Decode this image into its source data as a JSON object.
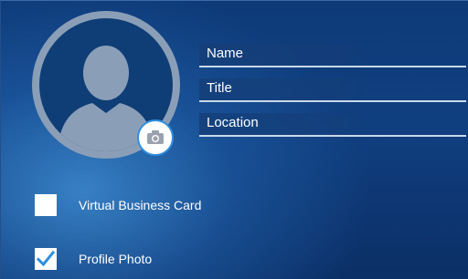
{
  "profile": {
    "avatar_icon": "person-silhouette-icon",
    "camera_icon": "camera-icon"
  },
  "fields": {
    "name_label": "Name",
    "title_label": "Title",
    "location_label": "Location"
  },
  "options": {
    "virtual_business_card": {
      "label": "Virtual Business Card",
      "checked": false
    },
    "profile_photo": {
      "label": "Profile Photo",
      "checked": true
    }
  },
  "colors": {
    "accent": "#2f8fe0",
    "background": "#0d3570",
    "avatar_ring": "#8a9fb7",
    "text": "#ffffff"
  }
}
